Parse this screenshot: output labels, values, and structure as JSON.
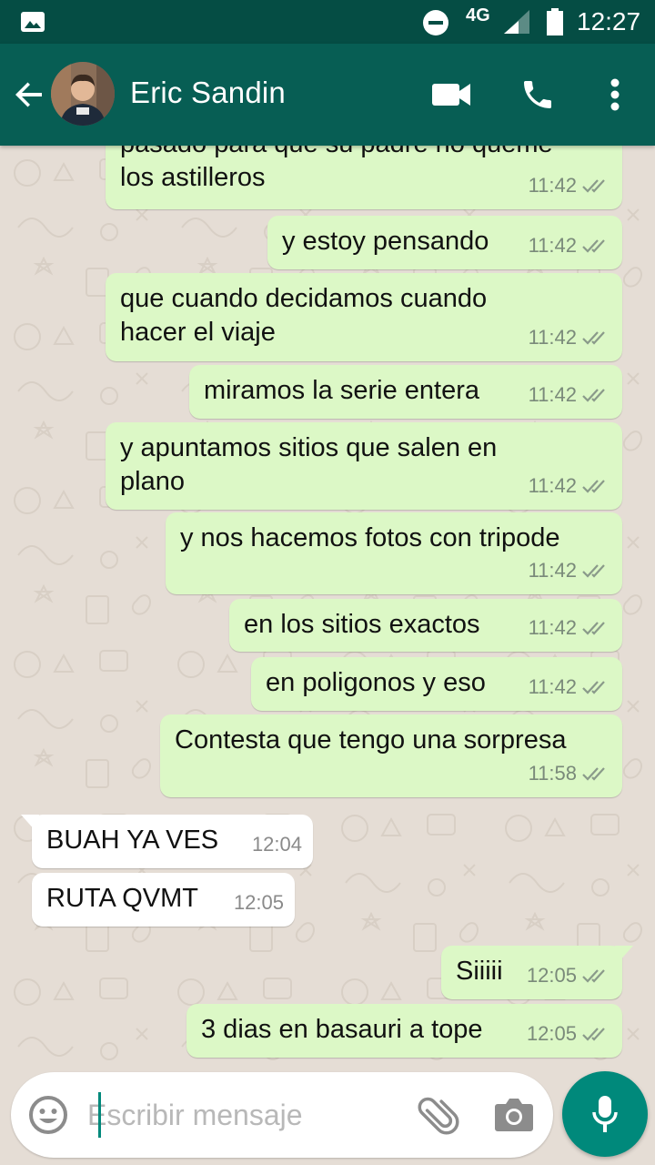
{
  "status_bar": {
    "network": "4G",
    "time": "12:27"
  },
  "header": {
    "contact_name": "Eric Sandin",
    "icons": [
      "back-arrow-icon",
      "video-call-icon",
      "phone-icon",
      "more-vert-icon"
    ]
  },
  "messages": [
    {
      "dir": "out",
      "lines": [
        "pasado para que su padre no queme",
        "los astilleros"
      ],
      "time": "11:42",
      "status": "read"
    },
    {
      "dir": "out",
      "lines": [
        "y estoy pensando"
      ],
      "time": "11:42",
      "status": "read"
    },
    {
      "dir": "out",
      "lines": [
        "que cuando decidamos cuando",
        "hacer el viaje"
      ],
      "time": "11:42",
      "status": "read"
    },
    {
      "dir": "out",
      "lines": [
        "miramos la serie entera"
      ],
      "time": "11:42",
      "status": "read"
    },
    {
      "dir": "out",
      "lines": [
        "y apuntamos sitios que salen en",
        "plano"
      ],
      "time": "11:42",
      "status": "read"
    },
    {
      "dir": "out",
      "lines": [
        "y nos hacemos fotos con tripode"
      ],
      "time": "11:42",
      "status": "read"
    },
    {
      "dir": "out",
      "lines": [
        "en los sitios exactos"
      ],
      "time": "11:42",
      "status": "read"
    },
    {
      "dir": "out",
      "lines": [
        "en poligonos y eso"
      ],
      "time": "11:42",
      "status": "read"
    },
    {
      "dir": "out",
      "lines": [
        "Contesta que tengo una sorpresa"
      ],
      "time": "11:58",
      "status": "read"
    },
    {
      "dir": "in",
      "lines": [
        "BUAH YA VES"
      ],
      "time": "12:04"
    },
    {
      "dir": "in",
      "lines": [
        "RUTA QVMT"
      ],
      "time": "12:05"
    },
    {
      "dir": "out",
      "lines": [
        "Siiiii"
      ],
      "time": "12:05",
      "status": "read"
    },
    {
      "dir": "out",
      "lines": [
        "3 dias en basauri a tope"
      ],
      "time": "12:05",
      "status": "read"
    }
  ],
  "composer": {
    "placeholder": "Escribir mensaje",
    "icons": [
      "emoji-icon",
      "attach-icon",
      "camera-icon",
      "mic-icon"
    ]
  },
  "colors": {
    "header": "#075e54",
    "status_bar": "#054d44",
    "outgoing_bubble": "#dcf8c6",
    "incoming_bubble": "#ffffff",
    "accent": "#00897b",
    "read_ticks": "#8a9a8a"
  }
}
